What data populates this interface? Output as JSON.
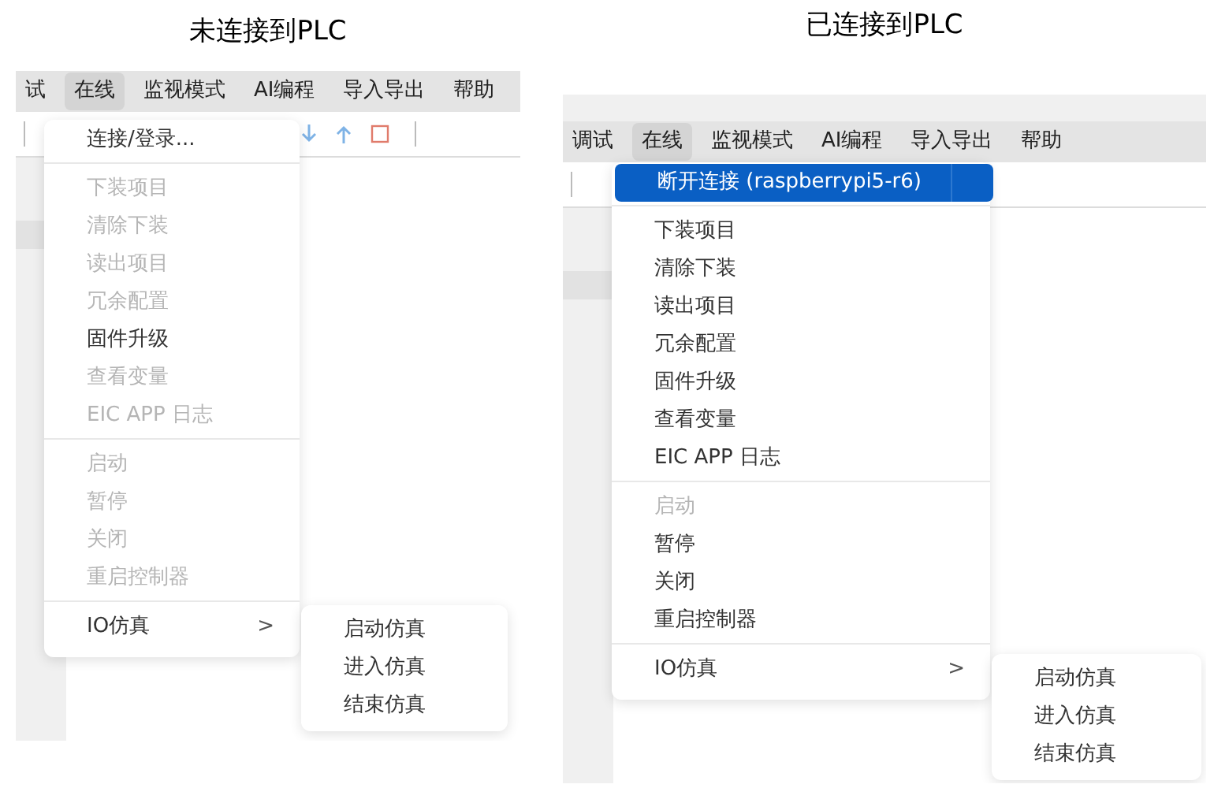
{
  "panels": [
    {
      "caption": "未连接到PLC",
      "menubar": [
        {
          "label": "试",
          "selected": false
        },
        {
          "label": "在线",
          "selected": true
        },
        {
          "label": "监视模式",
          "selected": false
        },
        {
          "label": "AI编程",
          "selected": false
        },
        {
          "label": "导入导出",
          "selected": false
        },
        {
          "label": "帮助",
          "selected": false
        }
      ],
      "menu": [
        [
          {
            "label": "连接/登录...",
            "kind": "item",
            "disabled": false,
            "selected": false
          }
        ],
        [
          {
            "label": "下装项目",
            "kind": "item",
            "disabled": true,
            "selected": false
          },
          {
            "label": "清除下装",
            "kind": "item",
            "disabled": true,
            "selected": false
          },
          {
            "label": "读出项目",
            "kind": "item",
            "disabled": true,
            "selected": false
          },
          {
            "label": "冗余配置",
            "kind": "item",
            "disabled": true,
            "selected": false
          },
          {
            "label": "固件升级",
            "kind": "item",
            "disabled": false,
            "selected": false
          },
          {
            "label": "查看变量",
            "kind": "item",
            "disabled": true,
            "selected": false
          },
          {
            "label": "EIC APP 日志",
            "kind": "item",
            "disabled": true,
            "selected": false
          }
        ],
        [
          {
            "label": "启动",
            "kind": "item",
            "disabled": true,
            "selected": false
          },
          {
            "label": "暂停",
            "kind": "item",
            "disabled": true,
            "selected": false
          },
          {
            "label": "关闭",
            "kind": "item",
            "disabled": true,
            "selected": false
          },
          {
            "label": "重启控制器",
            "kind": "item",
            "disabled": true,
            "selected": false
          }
        ],
        [
          {
            "label": "IO仿真",
            "kind": "submenu",
            "disabled": false,
            "selected": false,
            "chevron": ">"
          }
        ]
      ],
      "submenu": [
        "启动仿真",
        "进入仿真",
        "结束仿真"
      ]
    },
    {
      "caption": "已连接到PLC",
      "menubar": [
        {
          "label": "调试",
          "selected": false
        },
        {
          "label": "在线",
          "selected": true
        },
        {
          "label": "监视模式",
          "selected": false
        },
        {
          "label": "AI编程",
          "selected": false
        },
        {
          "label": "导入导出",
          "selected": false
        },
        {
          "label": "帮助",
          "selected": false
        }
      ],
      "menu": [
        [
          {
            "label": "断开连接 (raspberrypi5-r6)",
            "kind": "item",
            "disabled": false,
            "selected": true
          }
        ],
        [
          {
            "label": "下装项目",
            "kind": "item",
            "disabled": false,
            "selected": false
          },
          {
            "label": "清除下装",
            "kind": "item",
            "disabled": false,
            "selected": false
          },
          {
            "label": "读出项目",
            "kind": "item",
            "disabled": false,
            "selected": false
          },
          {
            "label": "冗余配置",
            "kind": "item",
            "disabled": false,
            "selected": false
          },
          {
            "label": "固件升级",
            "kind": "item",
            "disabled": false,
            "selected": false
          },
          {
            "label": "查看变量",
            "kind": "item",
            "disabled": false,
            "selected": false
          },
          {
            "label": "EIC APP 日志",
            "kind": "item",
            "disabled": false,
            "selected": false
          }
        ],
        [
          {
            "label": "启动",
            "kind": "item",
            "disabled": true,
            "selected": false
          },
          {
            "label": "暂停",
            "kind": "item",
            "disabled": false,
            "selected": false
          },
          {
            "label": "关闭",
            "kind": "item",
            "disabled": false,
            "selected": false
          },
          {
            "label": "重启控制器",
            "kind": "item",
            "disabled": false,
            "selected": false
          }
        ],
        [
          {
            "label": "IO仿真",
            "kind": "submenu",
            "disabled": false,
            "selected": false,
            "chevron": ">"
          }
        ]
      ],
      "submenu": [
        "启动仿真",
        "进入仿真",
        "结束仿真"
      ]
    }
  ]
}
